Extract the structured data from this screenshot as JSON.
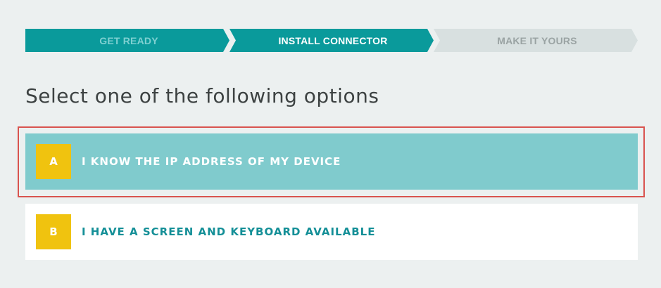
{
  "stepper": {
    "steps": [
      {
        "label": "GET READY",
        "state": "completed"
      },
      {
        "label": "INSTALL CONNECTOR",
        "state": "active"
      },
      {
        "label": "MAKE IT YOURS",
        "state": "upcoming"
      }
    ]
  },
  "main": {
    "heading": "Select one of the following options",
    "options": [
      {
        "letter": "A",
        "label": "I KNOW THE IP ADDRESS OF MY DEVICE",
        "highlighted": true
      },
      {
        "letter": "B",
        "label": "I HAVE A SCREEN AND KEYBOARD AVAILABLE",
        "highlighted": false
      }
    ]
  },
  "colors": {
    "background": "#ecf0f0",
    "step_active": "#0a9a9b",
    "step_upcoming": "#d8e0e0",
    "option_selected": "#80cbcd",
    "badge": "#f0c30f",
    "highlight_border": "#d9534f"
  }
}
